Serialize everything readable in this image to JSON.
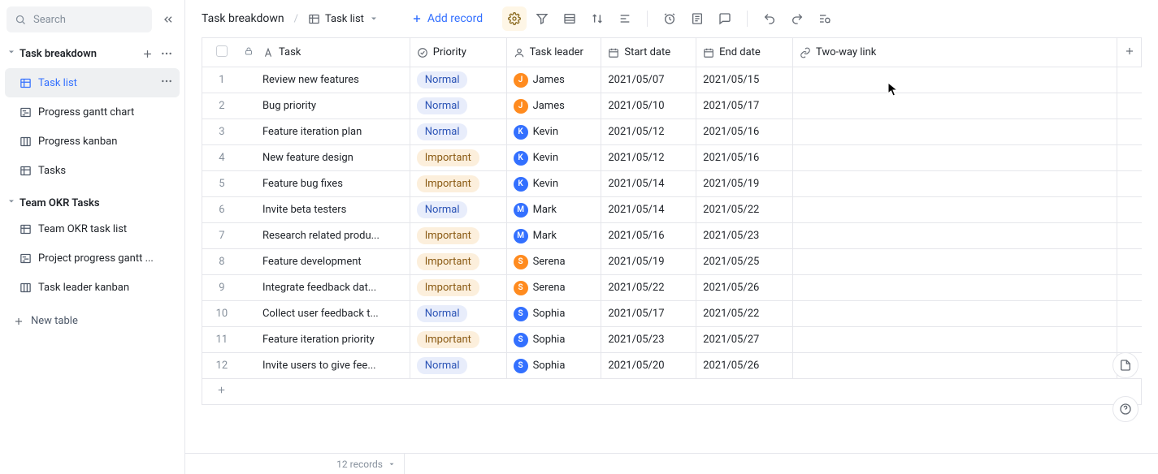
{
  "search_placeholder": "Search",
  "sections": {
    "a": {
      "title": "Task breakdown"
    },
    "b": {
      "title": "Team OKR Tasks"
    }
  },
  "tree": {
    "task_list": "Task list",
    "progress_gantt": "Progress gantt chart",
    "progress_kanban": "Progress kanban",
    "tasks": "Tasks",
    "okr_list": "Team OKR task list",
    "project_gantt": "Project progress gantt ...",
    "leader_kanban": "Task leader kanban"
  },
  "new_table": "New table",
  "breadcrumb": {
    "root": "Task breakdown",
    "view": "Task list"
  },
  "add_record": "Add record",
  "columns": {
    "task": "Task",
    "priority": "Priority",
    "leader": "Task leader",
    "start": "Start date",
    "end": "End date",
    "link": "Two-way link"
  },
  "priority_labels": {
    "normal": "Normal",
    "important": "Important"
  },
  "rows": [
    {
      "idx": "1",
      "task": "Review new features",
      "prio": "normal",
      "leader": "James",
      "av": "orange",
      "ini": "J",
      "start": "2021/05/07",
      "end": "2021/05/15"
    },
    {
      "idx": "2",
      "task": "Bug priority",
      "prio": "normal",
      "leader": "James",
      "av": "orange",
      "ini": "J",
      "start": "2021/05/10",
      "end": "2021/05/17"
    },
    {
      "idx": "3",
      "task": "Feature iteration plan",
      "prio": "normal",
      "leader": "Kevin",
      "av": "blue",
      "ini": "K",
      "start": "2021/05/12",
      "end": "2021/05/16"
    },
    {
      "idx": "4",
      "task": "New feature design",
      "prio": "important",
      "leader": "Kevin",
      "av": "blue",
      "ini": "K",
      "start": "2021/05/12",
      "end": "2021/05/16"
    },
    {
      "idx": "5",
      "task": "Feature bug fixes",
      "prio": "important",
      "leader": "Kevin",
      "av": "blue",
      "ini": "K",
      "start": "2021/05/14",
      "end": "2021/05/19"
    },
    {
      "idx": "6",
      "task": "Invite beta testers",
      "prio": "normal",
      "leader": "Mark",
      "av": "blue",
      "ini": "M",
      "start": "2021/05/14",
      "end": "2021/05/22"
    },
    {
      "idx": "7",
      "task": "Research related produ...",
      "prio": "important",
      "leader": "Mark",
      "av": "blue",
      "ini": "M",
      "start": "2021/05/16",
      "end": "2021/05/23"
    },
    {
      "idx": "8",
      "task": "Feature development",
      "prio": "important",
      "leader": "Serena",
      "av": "orange",
      "ini": "S",
      "start": "2021/05/19",
      "end": "2021/05/25"
    },
    {
      "idx": "9",
      "task": "Integrate feedback dat...",
      "prio": "important",
      "leader": "Serena",
      "av": "orange",
      "ini": "S",
      "start": "2021/05/22",
      "end": "2021/05/26"
    },
    {
      "idx": "10",
      "task": "Collect user feedback t...",
      "prio": "normal",
      "leader": "Sophia",
      "av": "blue",
      "ini": "S",
      "start": "2021/05/17",
      "end": "2021/05/22"
    },
    {
      "idx": "11",
      "task": "Feature iteration priority",
      "prio": "important",
      "leader": "Sophia",
      "av": "blue",
      "ini": "S",
      "start": "2021/05/23",
      "end": "2021/05/27"
    },
    {
      "idx": "12",
      "task": "Invite users to give fee...",
      "prio": "normal",
      "leader": "Sophia",
      "av": "blue",
      "ini": "S",
      "start": "2021/05/20",
      "end": "2021/05/26"
    }
  ],
  "record_count": "12 records"
}
